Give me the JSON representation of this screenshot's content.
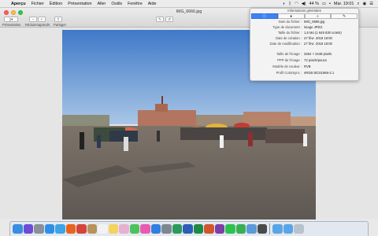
{
  "menubar": {
    "apple_symbol": "",
    "items": [
      "Aperçu",
      "Fichier",
      "Édition",
      "Présentation",
      "Aller",
      "Outils",
      "Fenêtre",
      "Aide"
    ],
    "battery": "44 %",
    "clock": "Mar. 19:01"
  },
  "window": {
    "title": "IMG_6666.jpg",
    "toolbar": {
      "view_label": "Présentation",
      "zoom_label": "Réduire/agrandir",
      "share_label": "Partager"
    }
  },
  "inspector": {
    "title": "Informations générales",
    "tabs": [
      {
        "icon": "info-icon",
        "glyph": "ⓘ"
      },
      {
        "icon": "info-dot-icon",
        "glyph": "●"
      },
      {
        "icon": "search-icon",
        "glyph": "⌕"
      },
      {
        "icon": "pen-icon",
        "glyph": "✎"
      }
    ],
    "rows": [
      {
        "key": "Nom du fichier :",
        "value": "IMG_6666.jpg"
      },
      {
        "key": "Type de document :",
        "value": "image JPEG"
      },
      {
        "key": "Taille du fichier :",
        "value": "1,6 Mo (1 649 630 octets)"
      },
      {
        "key": "Date de création :",
        "value": "27 févr. 2018 18:00"
      },
      {
        "key": "Date de modification :",
        "value": "27 févr. 2018 18:00"
      },
      {
        "key": "Taille de l'image :",
        "value": "3264 × 2448 pixels"
      },
      {
        "key": "PPP de l'image :",
        "value": "72 pixels/pouce"
      },
      {
        "key": "Modèle de couleur :",
        "value": "RVB"
      },
      {
        "key": "Profil ColorSync :",
        "value": "sRGB IEC61966-2.1"
      }
    ]
  },
  "dock": {
    "apps": [
      {
        "name": "finder-icon",
        "color": "#3a8de0"
      },
      {
        "name": "siri-icon",
        "color": "#6d4cd6"
      },
      {
        "name": "launchpad-icon",
        "color": "#8a8f99"
      },
      {
        "name": "safari-icon",
        "color": "#2f8fe8"
      },
      {
        "name": "twitter-icon",
        "color": "#3da4e6"
      },
      {
        "name": "firefox-icon",
        "color": "#e8641c"
      },
      {
        "name": "chrome-icon",
        "color": "#d6433b"
      },
      {
        "name": "contacts-icon",
        "color": "#b8925a"
      },
      {
        "name": "calendar-icon",
        "color": "#f2f2f2"
      },
      {
        "name": "notes-icon",
        "color": "#f4d35e"
      },
      {
        "name": "photos-icon",
        "color": "#e6b0d0"
      },
      {
        "name": "messages-icon",
        "color": "#4cc35a"
      },
      {
        "name": "itunes-icon",
        "color": "#e95bb2"
      },
      {
        "name": "app-store-icon",
        "color": "#2f7fe0"
      },
      {
        "name": "system-preferences-icon",
        "color": "#7f868f"
      },
      {
        "name": "vpn-icon",
        "color": "#2b9a5c"
      },
      {
        "name": "word-icon",
        "color": "#2b5fb8"
      },
      {
        "name": "excel-icon",
        "color": "#1f8a45"
      },
      {
        "name": "powerpoint-icon",
        "color": "#d0562e"
      },
      {
        "name": "onenote-icon",
        "color": "#7b3fa8"
      },
      {
        "name": "whatsapp-icon",
        "color": "#2bc24f"
      },
      {
        "name": "facetime-icon",
        "color": "#3aae55"
      },
      {
        "name": "preview-icon",
        "color": "#5b9ad8"
      },
      {
        "name": "camera-icon",
        "color": "#4a4a4a"
      }
    ],
    "right_items": [
      {
        "name": "downloads-folder-icon",
        "color": "#5aa5e6"
      },
      {
        "name": "documents-folder-icon",
        "color": "#5aa5e6"
      },
      {
        "name": "trash-icon",
        "color": "#b7c2cc"
      }
    ]
  }
}
